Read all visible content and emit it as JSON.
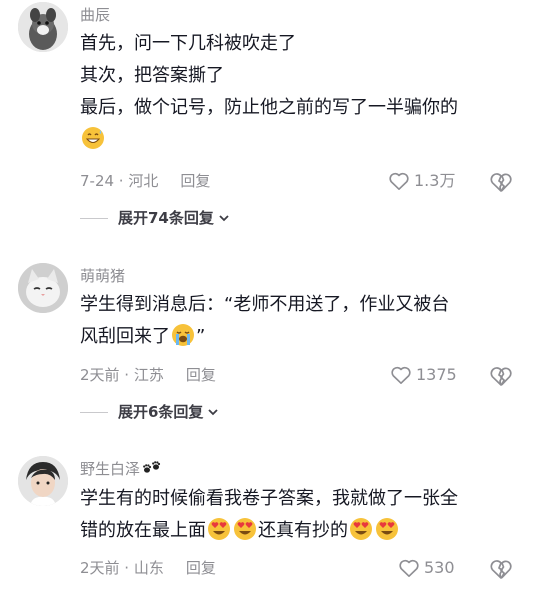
{
  "comments": [
    {
      "username": "曲辰",
      "lines": [
        "首先，问一下几科被吹走了",
        "其次，把答案撕了",
        "最后，做个记号，防止他之前的写了一半骗你的"
      ],
      "date_location": "7-24 · 河北",
      "reply_label": "回复",
      "likes": "1.3万",
      "expand_label": "展开74条回复"
    },
    {
      "username": "萌萌猪",
      "line1": "学生得到消息后：“老师不用送了，作业又被台",
      "line2_a": "风刮回来了",
      "line2_b": "”",
      "date_location": "2天前 · 江苏",
      "reply_label": "回复",
      "likes": "1375",
      "expand_label": "展开6条回复"
    },
    {
      "username": "野生白泽",
      "line1": "学生有的时候偷看我卷子答案，我就做了一张全",
      "line2_a": "错的放在最上面",
      "line2_b": "还真有抄的",
      "date_location": "2天前 · 山东",
      "reply_label": "回复",
      "likes": "530"
    }
  ],
  "icons": {
    "like": "heart-outline-icon",
    "dislike": "broken-heart-icon",
    "expand": "chevron-down-icon",
    "emoji_1": "grinning-sweat-emoji",
    "emoji_2": "loudly-crying-emoji",
    "emoji_3": "heart-eyes-emoji",
    "name_badge": "paw-prints-icon"
  },
  "colors": {
    "text": "#161823",
    "secondary": "#8e8e93",
    "emoji": "#f7c23a"
  }
}
